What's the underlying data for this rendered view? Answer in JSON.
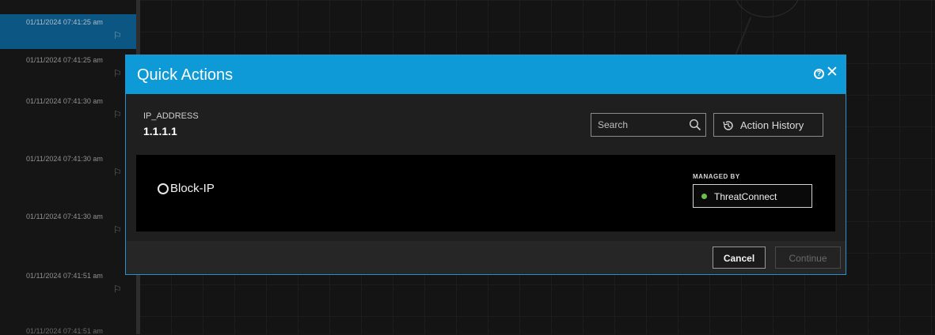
{
  "timeline": {
    "items": [
      {
        "timestamp": "01/11/2024 07:41:25 am",
        "selected": true
      },
      {
        "timestamp": "01/11/2024 07:41:25 am",
        "selected": false
      },
      {
        "timestamp": "01/11/2024 07:41:30 am",
        "selected": false
      },
      {
        "timestamp": "01/11/2024 07:41:30 am",
        "selected": false
      },
      {
        "timestamp": "01/11/2024 07:41:30 am",
        "selected": false
      },
      {
        "timestamp": "01/11/2024 07:41:51 am",
        "selected": false
      }
    ],
    "cut_off_item": "01/11/2024 07:41:51 am",
    "flag_icon": "flag-icon"
  },
  "modal": {
    "title": "Quick Actions",
    "help_icon": "help-icon",
    "close_icon": "close-icon",
    "header_color": "#0e9ad7",
    "field_label": "IP_ADDRESS",
    "field_value": "1.1.1.1",
    "search": {
      "placeholder": "Search",
      "icon": "search-icon"
    },
    "history_button": {
      "label": "Action History",
      "icon": "history-icon"
    },
    "actions": [
      {
        "label": "Block-IP",
        "managed_by_label": "MANAGED BY",
        "managed_by": "ThreatConnect",
        "status_color": "#6cc04a"
      }
    ],
    "footer": {
      "cancel_label": "Cancel",
      "continue_label": "Continue",
      "continue_disabled": true
    }
  }
}
